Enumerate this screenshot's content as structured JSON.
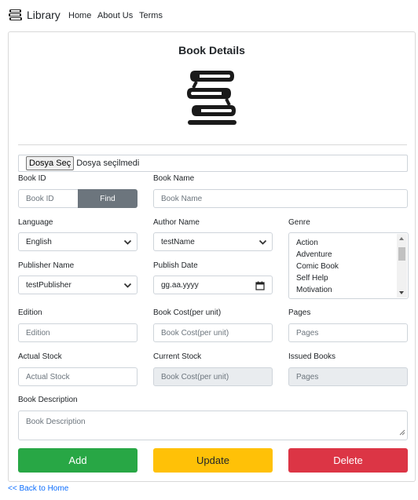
{
  "navbar": {
    "brand": "Library",
    "links": [
      "Home",
      "About Us",
      "Terms"
    ]
  },
  "card": {
    "title": "Book Details"
  },
  "file_input": {
    "button_label": "Dosya Seç",
    "status_text": "Dosya seçilmedi"
  },
  "form": {
    "book_id": {
      "label": "Book ID",
      "placeholder": "Book ID",
      "find_label": "Find"
    },
    "book_name": {
      "label": "Book Name",
      "placeholder": "Book Name"
    },
    "language": {
      "label": "Language",
      "value": "English"
    },
    "author_name": {
      "label": "Author Name",
      "value": "testName"
    },
    "genre": {
      "label": "Genre",
      "options": [
        "Action",
        "Adventure",
        "Comic Book",
        "Self Help",
        "Motivation"
      ]
    },
    "publisher_name": {
      "label": "Publisher Name",
      "value": "testPublisher"
    },
    "publish_date": {
      "label": "Publish Date",
      "placeholder": "gg.aa.yyyy"
    },
    "edition": {
      "label": "Edition",
      "placeholder": "Edition"
    },
    "book_cost": {
      "label": "Book Cost(per unit)",
      "placeholder": "Book Cost(per unit)"
    },
    "pages": {
      "label": "Pages",
      "placeholder": "Pages"
    },
    "actual_stock": {
      "label": "Actual Stock",
      "placeholder": "Actual Stock"
    },
    "current_stock": {
      "label": "Current Stock",
      "placeholder": "Book Cost(per unit)"
    },
    "issued_books": {
      "label": "Issued Books",
      "placeholder": "Pages"
    },
    "book_description": {
      "label": "Book Description",
      "placeholder": "Book Description"
    }
  },
  "actions": {
    "add": "Add",
    "update": "Update",
    "delete": "Delete"
  },
  "back_link": "<< Back to Home",
  "colors": {
    "add": "#28a745",
    "update": "#ffc107",
    "delete": "#dc3545",
    "find": "#6c757d",
    "link": "#0d6efd"
  }
}
